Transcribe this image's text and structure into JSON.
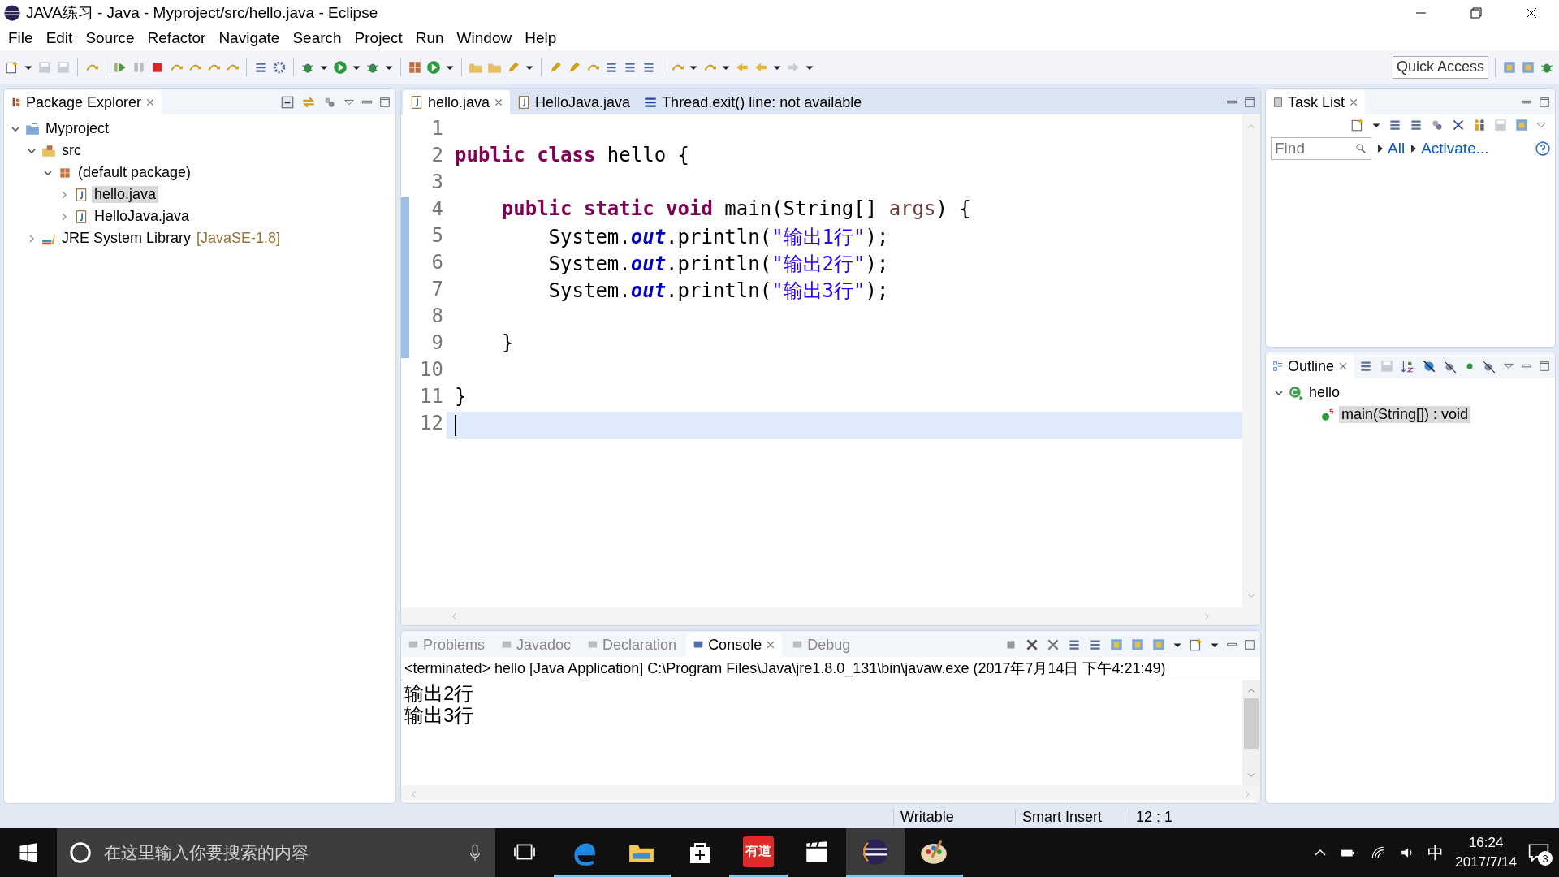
{
  "window": {
    "title": "JAVA练习 - Java - Myproject/src/hello.java - Eclipse"
  },
  "menu": [
    "File",
    "Edit",
    "Source",
    "Refactor",
    "Navigate",
    "Search",
    "Project",
    "Run",
    "Window",
    "Help"
  ],
  "toolbar": {
    "quick_access": {
      "placeholder": "Quick Access"
    }
  },
  "package_explorer": {
    "title": "Package Explorer",
    "tree": [
      {
        "label": "Myproject",
        "kind": "project",
        "expanded": true,
        "selected": false,
        "children": [
          {
            "label": "src",
            "kind": "source-folder",
            "expanded": true,
            "selected": false,
            "children": [
              {
                "label": "(default package)",
                "kind": "package",
                "expanded": true,
                "selected": false,
                "children": [
                  {
                    "label": "hello.java",
                    "kind": "java-file",
                    "expanded": false,
                    "selected": true
                  },
                  {
                    "label": "HelloJava.java",
                    "kind": "java-file",
                    "expanded": false,
                    "selected": false
                  }
                ]
              }
            ]
          },
          {
            "label": "JRE System Library",
            "decoration": "[JavaSE-1.8]",
            "kind": "library",
            "expanded": false,
            "selected": false
          }
        ]
      }
    ]
  },
  "editor": {
    "tabs": [
      {
        "label": "hello.java",
        "kind": "java-file",
        "selected": true
      },
      {
        "label": "HelloJava.java",
        "kind": "java-file",
        "selected": false
      },
      {
        "label": "Thread.exit() line: not available",
        "kind": "stack-frame",
        "selected": false
      }
    ],
    "lines": [
      {
        "number": "1",
        "current": false
      },
      {
        "number": "2",
        "current": false,
        "tokens": [
          {
            "kind": "keyword",
            "text": "public"
          },
          {
            "kind": "keyword",
            "text": " class"
          },
          {
            "kind": "plain",
            "text": " hello {"
          }
        ]
      },
      {
        "number": "3",
        "current": false
      },
      {
        "number": "4",
        "current": false,
        "tokens": [
          {
            "kind": "keyword",
            "text": "    public"
          },
          {
            "kind": "keyword",
            "text": " static"
          },
          {
            "kind": "keyword",
            "text": " void"
          },
          {
            "kind": "plain",
            "text": " main(String[] "
          },
          {
            "kind": "param",
            "text": "args"
          },
          {
            "kind": "plain",
            "text": ") {"
          }
        ]
      },
      {
        "number": "5",
        "current": false,
        "tokens": [
          {
            "kind": "plain",
            "text": "        System."
          },
          {
            "kind": "field",
            "text": "out"
          },
          {
            "kind": "plain",
            "text": ".println("
          },
          {
            "kind": "string",
            "text": "\"输出1行\""
          },
          {
            "kind": "plain",
            "text": ");"
          }
        ]
      },
      {
        "number": "6",
        "current": false,
        "tokens": [
          {
            "kind": "plain",
            "text": "        System."
          },
          {
            "kind": "field",
            "text": "out"
          },
          {
            "kind": "plain",
            "text": ".println("
          },
          {
            "kind": "string",
            "text": "\"输出2行\""
          },
          {
            "kind": "plain",
            "text": ");"
          }
        ]
      },
      {
        "number": "7",
        "current": false,
        "tokens": [
          {
            "kind": "plain",
            "text": "        System."
          },
          {
            "kind": "field",
            "text": "out"
          },
          {
            "kind": "plain",
            "text": ".println("
          },
          {
            "kind": "string",
            "text": "\"输出3行\""
          },
          {
            "kind": "plain",
            "text": ");"
          }
        ]
      },
      {
        "number": "8",
        "current": false
      },
      {
        "number": "9",
        "current": false,
        "tokens": [
          {
            "kind": "plain",
            "text": "    }"
          }
        ]
      },
      {
        "number": "10",
        "current": false
      },
      {
        "number": "11",
        "current": false,
        "tokens": [
          {
            "kind": "plain",
            "text": "}"
          }
        ]
      },
      {
        "number": "12",
        "current": true
      }
    ]
  },
  "task_list": {
    "title": "Task List",
    "find": {
      "placeholder": "Find"
    },
    "links": [
      "All",
      "Activate..."
    ]
  },
  "outline": {
    "title": "Outline",
    "tree": [
      {
        "label": "hello",
        "kind": "class",
        "expanded": true,
        "selected": false,
        "children": [
          {
            "label": "main(String[]) : void",
            "kind": "method",
            "expanded": false,
            "selected": true
          }
        ]
      }
    ]
  },
  "console": {
    "tabs": [
      {
        "label": "Problems",
        "selected": false
      },
      {
        "label": "Javadoc",
        "selected": false
      },
      {
        "label": "Declaration",
        "selected": false
      },
      {
        "label": "Console",
        "selected": true
      },
      {
        "label": "Debug",
        "selected": false
      }
    ],
    "header": "<terminated> hello [Java Application] C:\\Program Files\\Java\\jre1.8.0_131\\bin\\javaw.exe (2017年7月14日 下午4:21:49)",
    "output": [
      "输出2行",
      "输出3行"
    ]
  },
  "status_bar": [
    "Writable",
    "Smart Insert",
    "12 : 1"
  ],
  "taskbar": {
    "search": {
      "placeholder": "在这里输入你要搜索的内容"
    },
    "apps": [
      {
        "kind": "edge",
        "running": true
      },
      {
        "kind": "explorer",
        "running": true
      },
      {
        "kind": "store",
        "running": false
      },
      {
        "kind": "youdao",
        "label": "有道",
        "running": true
      },
      {
        "kind": "video",
        "running": false
      },
      {
        "kind": "eclipse",
        "running": true
      },
      {
        "kind": "paint",
        "running": true
      }
    ],
    "ime": "中",
    "time": "16:24",
    "date": "2017/7/14",
    "notifications": "3"
  }
}
